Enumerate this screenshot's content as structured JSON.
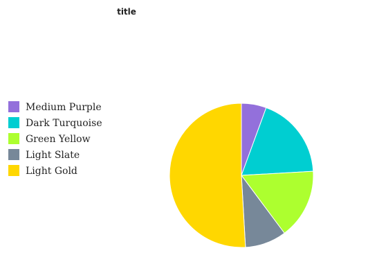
{
  "chart_data": {
    "type": "pie",
    "title": "title",
    "legend_position": "left",
    "slices": [
      {
        "label": "Medium Purple",
        "value": 5.6,
        "color": "#9370db"
      },
      {
        "label": "Dark Turquoise",
        "value": 18.5,
        "color": "#00ced1"
      },
      {
        "label": "Green Yellow",
        "value": 15.7,
        "color": "#adff2f"
      },
      {
        "label": "Light Slate",
        "value": 9.3,
        "color": "#778899"
      },
      {
        "label": "Light Gold",
        "value": 50.9,
        "color": "#ffd700"
      }
    ]
  }
}
